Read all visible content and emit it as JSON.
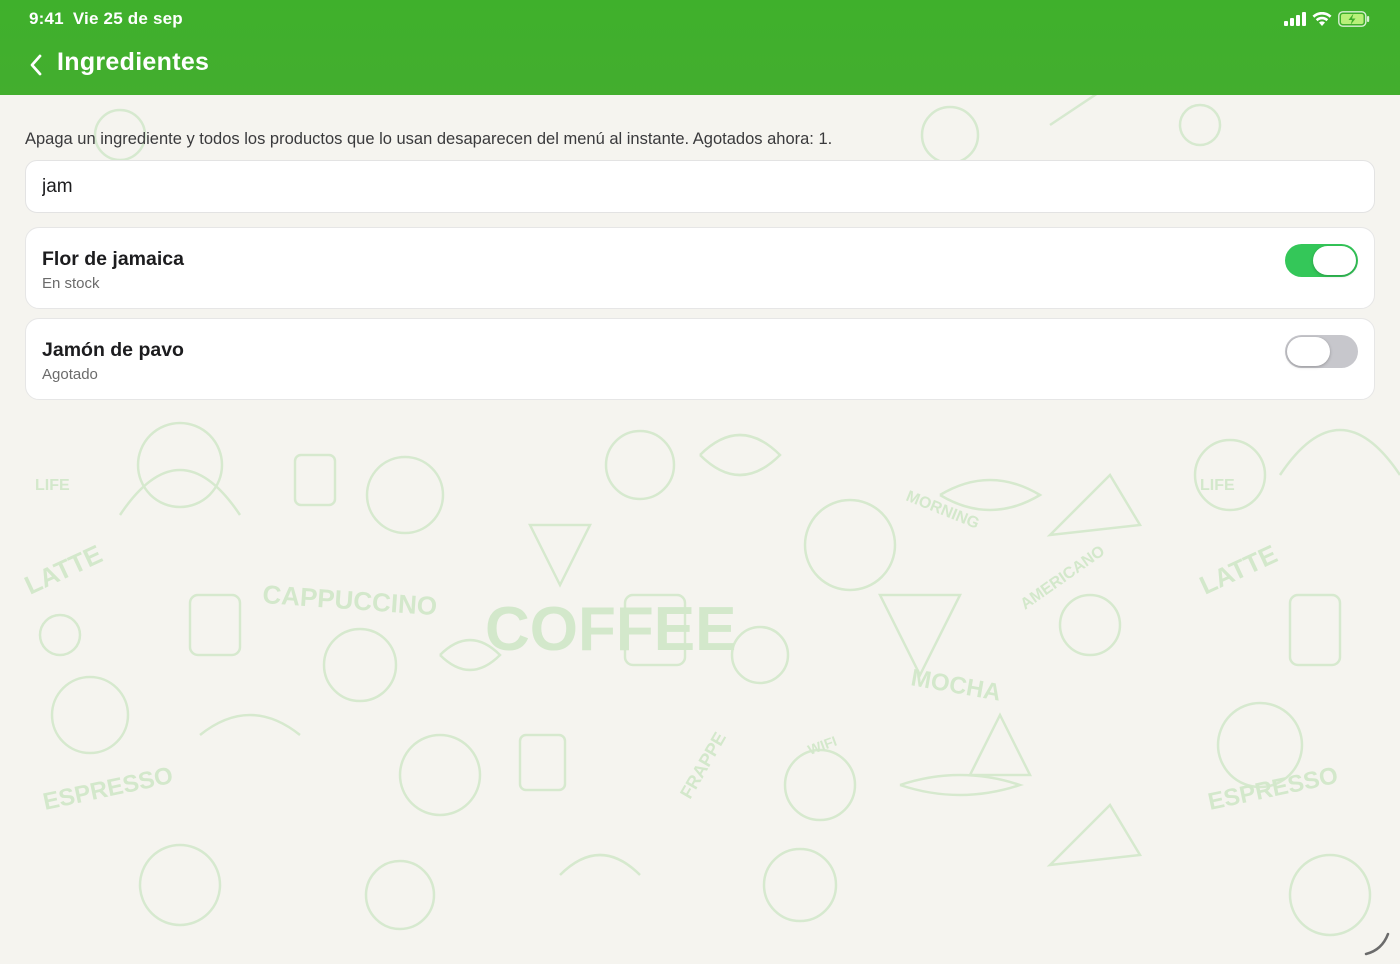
{
  "status_bar": {
    "time": "9:41",
    "date": "Vie 25 de sep",
    "icons": [
      "signal-icon",
      "wifi-icon",
      "battery-charging-icon"
    ]
  },
  "nav": {
    "back_icon": "chevron-left-icon",
    "title": "Ingredientes"
  },
  "info": {
    "text": "Apaga un ingrediente y todos los productos que lo usan desaparecen del menú al instante. Agotados ahora: 1."
  },
  "search": {
    "value": "jam"
  },
  "ingredients": [
    {
      "name": "Flor de jamaica",
      "status": "En stock",
      "enabled": true
    },
    {
      "name": "Jamón de pavo",
      "status": "Agotado",
      "enabled": false
    }
  ],
  "background_watermark": {
    "words": [
      "COFFEE",
      "CAPPUCCINO",
      "LATTE",
      "ESPRESSO",
      "MOCHA",
      "FRAPPE",
      "MORNING",
      "AMERICANO",
      "WIFI",
      "LIFE"
    ]
  },
  "colors": {
    "header_green": "#3fb02c",
    "toggle_on": "#34c759",
    "toggle_off": "#c7c7cc",
    "background": "#f5f4ef",
    "doodle": "#cfe8c6"
  }
}
